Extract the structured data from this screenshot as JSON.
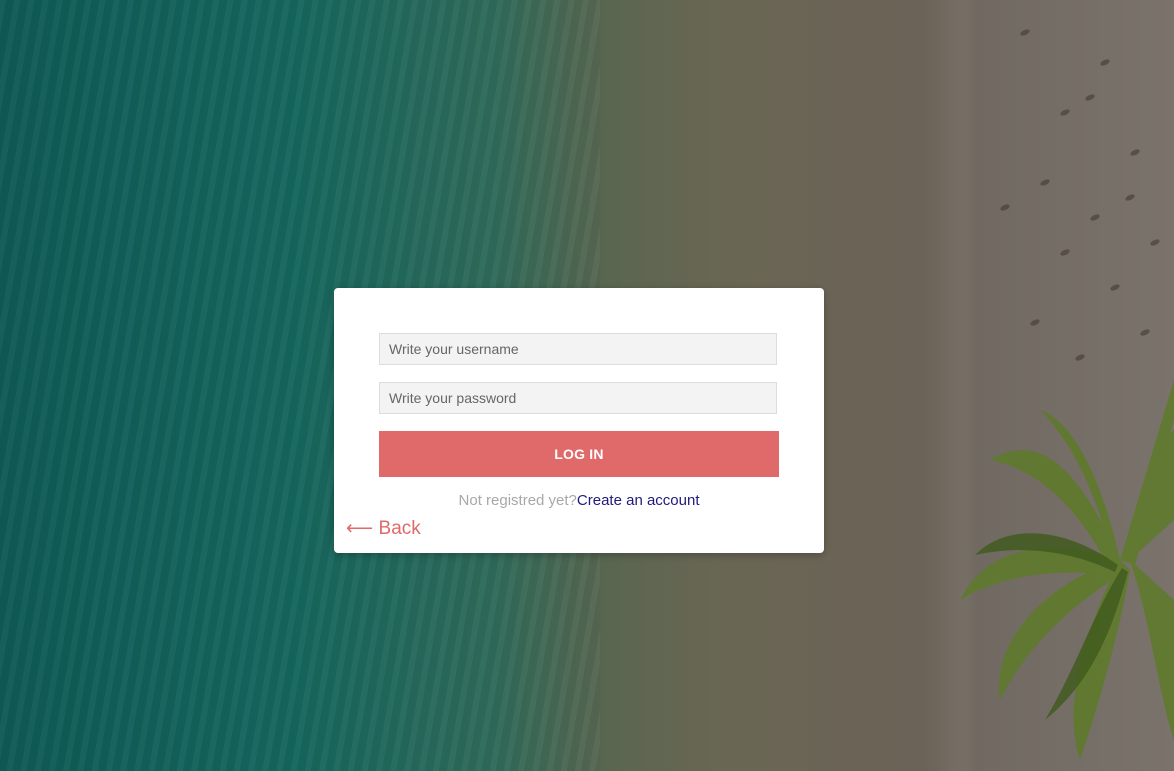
{
  "login_form": {
    "username_placeholder": "Write your username",
    "password_placeholder": "Write your password",
    "login_button_label": "LOG IN",
    "register_prompt": "Not registred yet?",
    "register_link": "Create an account",
    "back_arrow": "⟵",
    "back_label": "Back"
  },
  "colors": {
    "accent": "#e06a69",
    "link": "#1f1a7a",
    "muted_text": "#a8a8a8",
    "card_background": "#ffffff",
    "input_background": "#f3f3f3"
  },
  "background": {
    "icon": "beach-aerial-photo"
  }
}
